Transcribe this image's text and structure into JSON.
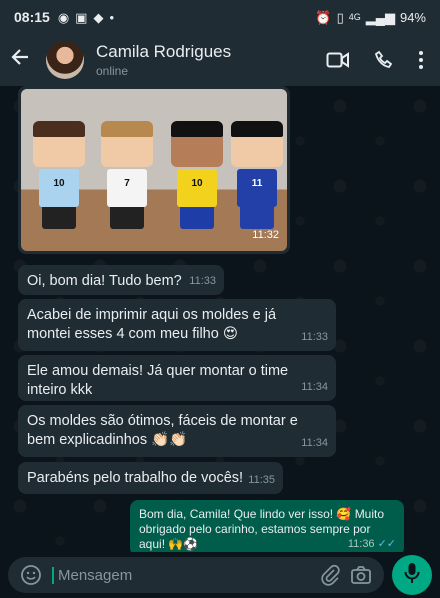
{
  "status_bar": {
    "time": "08:15",
    "battery": "94%",
    "network": "4G"
  },
  "header": {
    "contact_name": "Camila Rodrigues",
    "contact_status": "online"
  },
  "messages": [
    {
      "direction": "in",
      "type": "image",
      "time": "11:32"
    },
    {
      "direction": "in",
      "text": "Oi, bom dia! Tudo bem?",
      "time": "11:33"
    },
    {
      "direction": "in",
      "text": "Acabei de imprimir aqui os moldes e já montei esses 4 com meu filho 😍",
      "time": "11:33"
    },
    {
      "direction": "in",
      "text": "Ele amou demais! Já quer montar o time inteiro kkk",
      "time": "11:34"
    },
    {
      "direction": "in",
      "text": "Os moldes são ótimos, fáceis de montar e bem explicadinhos 👏🏻👏🏻",
      "time": "11:34"
    },
    {
      "direction": "in",
      "text": "Parabéns pelo trabalho de vocês!",
      "time": "11:35"
    },
    {
      "direction": "out",
      "text": "Bom dia, Camila! Que lindo ver isso! 🥰 Muito obrigado pelo carinho, estamos sempre por aqui! 🙌⚽",
      "time": "11:36",
      "read": "✓✓"
    }
  ],
  "input": {
    "placeholder": "Mensagem"
  },
  "photo_figures": [
    {
      "number": "10",
      "shirt": "#a9d3ef"
    },
    {
      "number": "7",
      "shirt": "#f4f4f4"
    },
    {
      "number": "10",
      "shirt": "#f2d21c"
    },
    {
      "number": "11",
      "shirt": "#2340a8"
    }
  ],
  "colors": {
    "incoming_bubble": "#1f2c34",
    "outgoing_bubble": "#005c4b",
    "accent": "#00a884",
    "read_ticks": "#53bdeb"
  }
}
